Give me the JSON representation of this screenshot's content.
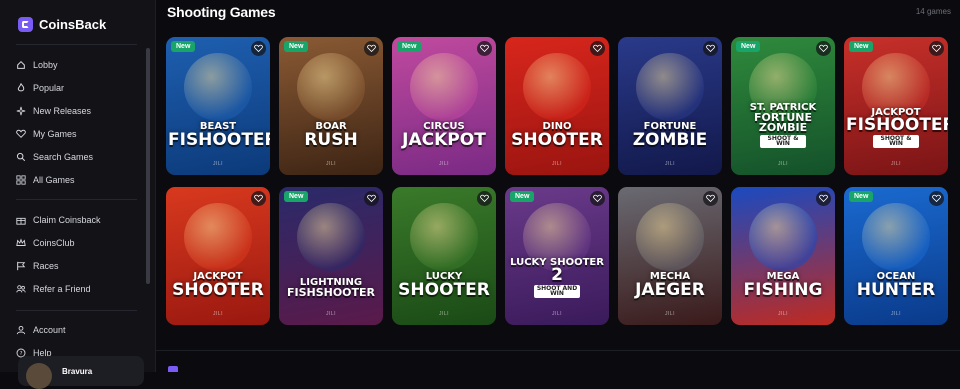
{
  "app": {
    "name": "CoinsBack"
  },
  "sidebar": {
    "main_items": [
      {
        "label": "Lobby",
        "icon": "home-icon"
      },
      {
        "label": "Popular",
        "icon": "flame-icon"
      },
      {
        "label": "New Releases",
        "icon": "sparkle-icon"
      },
      {
        "label": "My Games",
        "icon": "heart-icon"
      },
      {
        "label": "Search Games",
        "icon": "search-icon"
      },
      {
        "label": "All Games",
        "icon": "grid-icon"
      }
    ],
    "secondary_items": [
      {
        "label": "Claim Coinsback",
        "icon": "gift-icon"
      },
      {
        "label": "CoinsClub",
        "icon": "crown-icon"
      },
      {
        "label": "Races",
        "icon": "flag-icon"
      },
      {
        "label": "Refer a Friend",
        "icon": "users-icon"
      }
    ],
    "account_items": [
      {
        "label": "Account",
        "icon": "user-icon"
      },
      {
        "label": "Help",
        "icon": "help-icon"
      }
    ],
    "profile": {
      "name": "Bravura"
    }
  },
  "section": {
    "title": "Shooting Games",
    "count": "14 games"
  },
  "games": [
    {
      "small": "Beast",
      "big": "Fishooter",
      "sub": "",
      "provider": "JILI",
      "is_new": true,
      "badge": "New",
      "colors": [
        "#1e5fb0",
        "#0c3a7a"
      ]
    },
    {
      "small": "Boar",
      "big": "Rush",
      "sub": "",
      "provider": "JILI",
      "is_new": true,
      "badge": "New",
      "colors": [
        "#8a5a34",
        "#3d2414"
      ]
    },
    {
      "small": "Circus",
      "big": "Jackpot",
      "sub": "",
      "provider": "JILI",
      "is_new": true,
      "badge": "New",
      "colors": [
        "#c04a9e",
        "#7a2a85"
      ]
    },
    {
      "small": "Dino",
      "big": "Shooter",
      "sub": "",
      "provider": "JILI",
      "is_new": false,
      "badge": "",
      "colors": [
        "#d8261c",
        "#9a1410"
      ]
    },
    {
      "small": "Fortune",
      "big": "Zombie",
      "sub": "",
      "provider": "JILI",
      "is_new": false,
      "badge": "",
      "colors": [
        "#2a3a8a",
        "#12184a"
      ]
    },
    {
      "small": "St. Patrick",
      "big": "Fortune Zombie",
      "sub": "Shoot & Win",
      "provider": "JILI",
      "is_new": true,
      "badge": "New",
      "colors": [
        "#2f8a3c",
        "#14512a"
      ]
    },
    {
      "small": "Jackpot",
      "big": "Fishooter",
      "sub": "Shoot & Win",
      "provider": "JILI",
      "is_new": true,
      "badge": "New",
      "colors": [
        "#c8302a",
        "#7a1416"
      ]
    },
    {
      "small": "Jackpot",
      "big": "Shooter",
      "sub": "",
      "provider": "JILI",
      "is_new": false,
      "badge": "",
      "colors": [
        "#d8391e",
        "#9a1810"
      ]
    },
    {
      "small": "Lightning",
      "big": "Fishshooter",
      "sub": "",
      "provider": "JILI",
      "is_new": true,
      "badge": "New",
      "colors": [
        "#2a2a6a",
        "#5a1a4a"
      ]
    },
    {
      "small": "Lucky",
      "big": "Shooter",
      "sub": "",
      "provider": "JILI",
      "is_new": false,
      "badge": "",
      "colors": [
        "#3a7a2a",
        "#1a4a16"
      ]
    },
    {
      "small": "Lucky Shooter",
      "big": "2",
      "sub": "Shoot and Win",
      "provider": "JILI",
      "is_new": true,
      "badge": "New",
      "colors": [
        "#6a3a8a",
        "#3a1a5a"
      ]
    },
    {
      "small": "Mecha",
      "big": "Jaeger",
      "sub": "",
      "provider": "JILI",
      "is_new": false,
      "badge": "",
      "colors": [
        "#6a6a72",
        "#3a1a1a"
      ]
    },
    {
      "small": "Mega",
      "big": "Fishing",
      "sub": "",
      "provider": "JILI",
      "is_new": false,
      "badge": "",
      "colors": [
        "#1a4ac0",
        "#c02a20"
      ]
    },
    {
      "small": "Ocean",
      "big": "Hunter",
      "sub": "",
      "provider": "JILI",
      "is_new": true,
      "badge": "New",
      "colors": [
        "#1a6ad0",
        "#0a3a8a"
      ]
    }
  ]
}
